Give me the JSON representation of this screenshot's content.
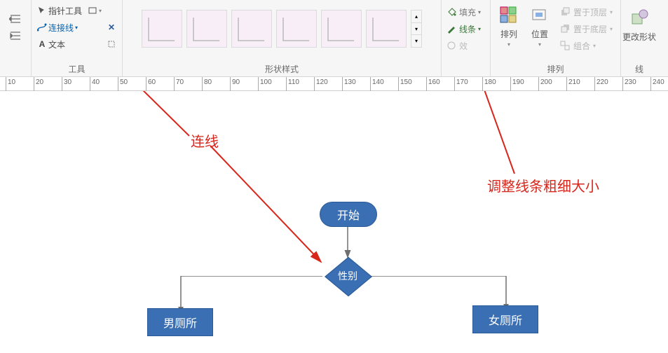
{
  "ribbon": {
    "tools_group_label": "工具",
    "pointer_tool": "指针工具",
    "connector_tool": "连接线",
    "text_tool": "文本",
    "styles_group_label": "形状样式",
    "fill_label": "填充",
    "line_label": "线条",
    "effect_label": "效",
    "arrange_label": "排列",
    "arrange_btn": "排列",
    "position_btn": "位置",
    "bring_front": "置于顶层",
    "send_back": "置于底层",
    "group_btn": "组合",
    "change_shape": "更改形状",
    "change_group_label": "线"
  },
  "ruler_ticks": [
    10,
    20,
    30,
    40,
    50,
    60,
    70,
    80,
    90,
    100,
    110,
    120,
    130,
    140,
    150,
    160,
    170,
    180,
    190,
    200,
    210,
    220,
    230,
    240
  ],
  "annotations": {
    "connect": "连线",
    "adjust_line": "调整线条粗细大小"
  },
  "flowchart": {
    "start": "开始",
    "decision": "性别",
    "male": "男厕所",
    "female": "女厕所"
  }
}
